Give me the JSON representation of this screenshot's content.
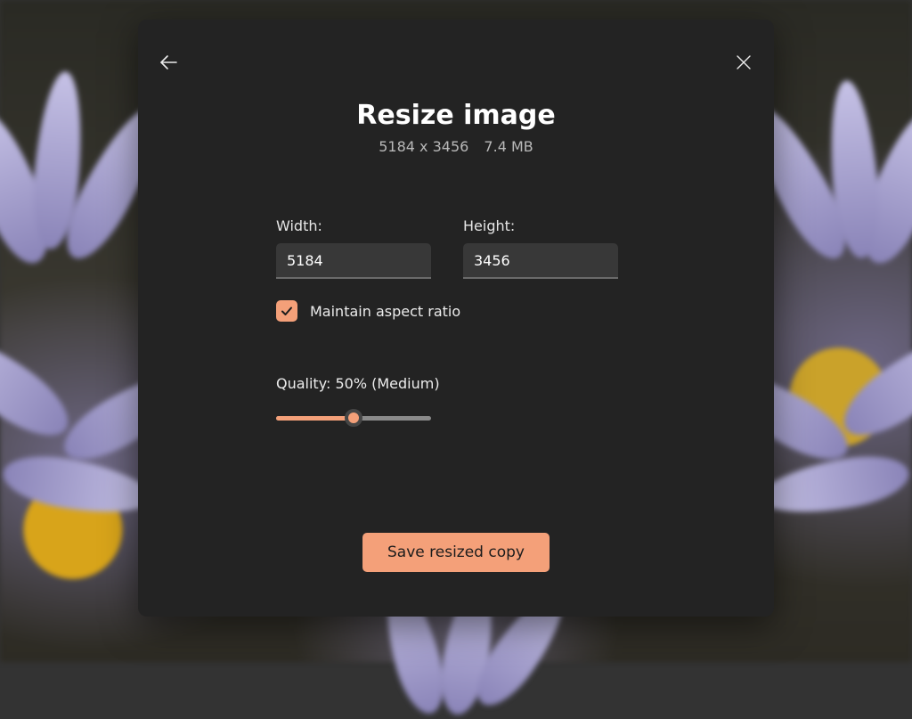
{
  "dialog": {
    "title": "Resize image",
    "dimensions": "5184 x 3456",
    "filesize": "7.4 MB",
    "width_label": "Width:",
    "height_label": "Height:",
    "width_value": "5184",
    "height_value": "3456",
    "aspect_checked": true,
    "aspect_label": "Maintain aspect ratio",
    "quality_percent": 50,
    "quality_label": "Quality: 50% (Medium)",
    "save_label": "Save resized copy"
  },
  "colors": {
    "accent": "#f4a079",
    "panel": "#232323",
    "input": "#383838"
  }
}
